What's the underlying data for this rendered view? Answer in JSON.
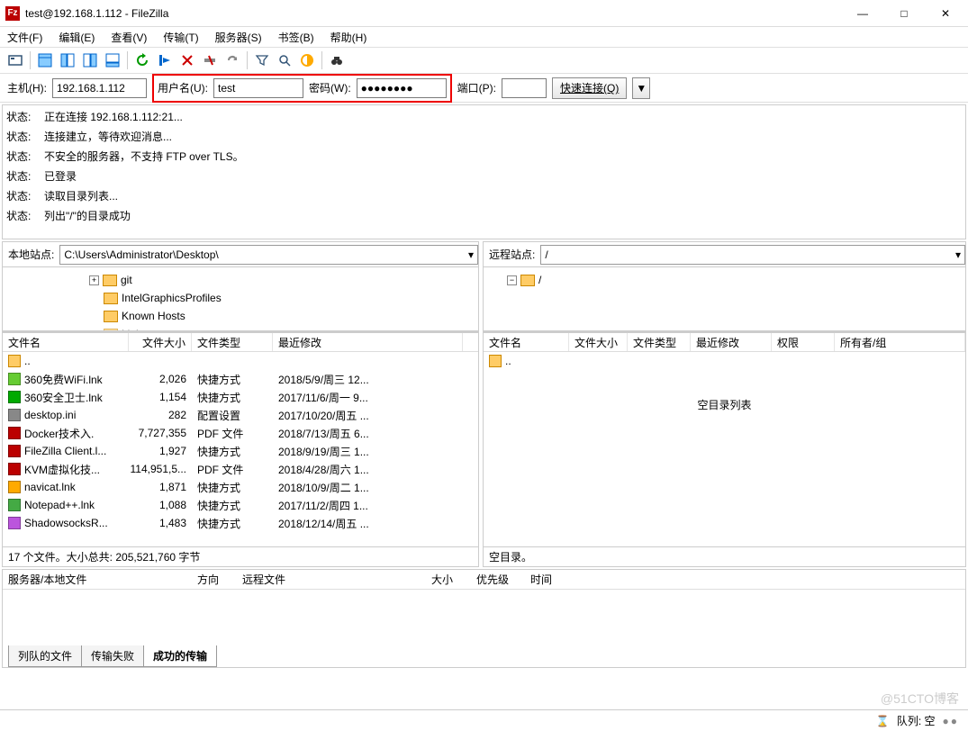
{
  "title": "test@192.168.1.112 - FileZilla",
  "window": {
    "min": "—",
    "max": "□",
    "close": "✕"
  },
  "menu": [
    "文件(F)",
    "编辑(E)",
    "查看(V)",
    "传输(T)",
    "服务器(S)",
    "书签(B)",
    "帮助(H)"
  ],
  "quickconnect": {
    "host_label": "主机(H):",
    "host_value": "192.168.1.112",
    "user_label": "用户名(U):",
    "user_value": "test",
    "pass_label": "密码(W):",
    "pass_value": "●●●●●●●●",
    "port_label": "端口(P):",
    "port_value": "",
    "connect_label": "快速连接(Q)",
    "drop": "▼"
  },
  "log_label": "状态:",
  "log": [
    "正在连接 192.168.1.112:21...",
    "连接建立，等待欢迎消息...",
    "不安全的服务器，不支持 FTP over TLS。",
    "已登录",
    "读取目录列表...",
    "列出\"/\"的目录成功"
  ],
  "local": {
    "site_label": "本地站点:",
    "path": "C:\\Users\\Administrator\\Desktop\\",
    "tree": [
      "git",
      "IntelGraphicsProfiles",
      "Known Hosts",
      "Links"
    ],
    "cols": {
      "name": "文件名",
      "size": "文件大小",
      "type": "文件类型",
      "mod": "最近修改"
    },
    "up": "..",
    "files": [
      {
        "ico": "#6c3",
        "name": "360免费WiFi.lnk",
        "size": "2,026",
        "type": "快捷方式",
        "mod": "2018/5/9/周三 12..."
      },
      {
        "ico": "#0a0",
        "name": "360安全卫士.lnk",
        "size": "1,154",
        "type": "快捷方式",
        "mod": "2017/11/6/周一 9..."
      },
      {
        "ico": "#888",
        "name": "desktop.ini",
        "size": "282",
        "type": "配置设置",
        "mod": "2017/10/20/周五 ..."
      },
      {
        "ico": "#b00",
        "name": "Docker技术入.",
        "size": "7,727,355",
        "type": "PDF 文件",
        "mod": "2018/7/13/周五 6..."
      },
      {
        "ico": "#b00",
        "name": "FileZilla Client.l...",
        "size": "1,927",
        "type": "快捷方式",
        "mod": "2018/9/19/周三 1..."
      },
      {
        "ico": "#b00",
        "name": "KVM虚拟化技...",
        "size": "114,951,5...",
        "type": "PDF 文件",
        "mod": "2018/4/28/周六 1..."
      },
      {
        "ico": "#fa0",
        "name": "navicat.lnk",
        "size": "1,871",
        "type": "快捷方式",
        "mod": "2018/10/9/周二 1..."
      },
      {
        "ico": "#4a4",
        "name": "Notepad++.lnk",
        "size": "1,088",
        "type": "快捷方式",
        "mod": "2017/11/2/周四 1..."
      },
      {
        "ico": "#b5d",
        "name": "ShadowsocksR...",
        "size": "1,483",
        "type": "快捷方式",
        "mod": "2018/12/14/周五 ..."
      }
    ],
    "status": "17 个文件。大小总共: 205,521,760 字节"
  },
  "remote": {
    "site_label": "远程站点:",
    "path": "/",
    "tree_root": "/",
    "cols": {
      "name": "文件名",
      "size": "文件大小",
      "type": "文件类型",
      "mod": "最近修改",
      "perm": "权限",
      "owner": "所有者/组"
    },
    "up": "..",
    "empty": "空目录列表",
    "status": "空目录。"
  },
  "queue": {
    "cols": {
      "server": "服务器/本地文件",
      "dir": "方向",
      "remote": "远程文件",
      "size": "大小",
      "prio": "优先级",
      "time": "时间"
    }
  },
  "tabs": {
    "queued": "列队的文件",
    "failed": "传输失败",
    "success": "成功的传输"
  },
  "statusbar": {
    "queue": "队列: 空",
    "dot": "●●"
  },
  "watermark": "@51CTO博客"
}
